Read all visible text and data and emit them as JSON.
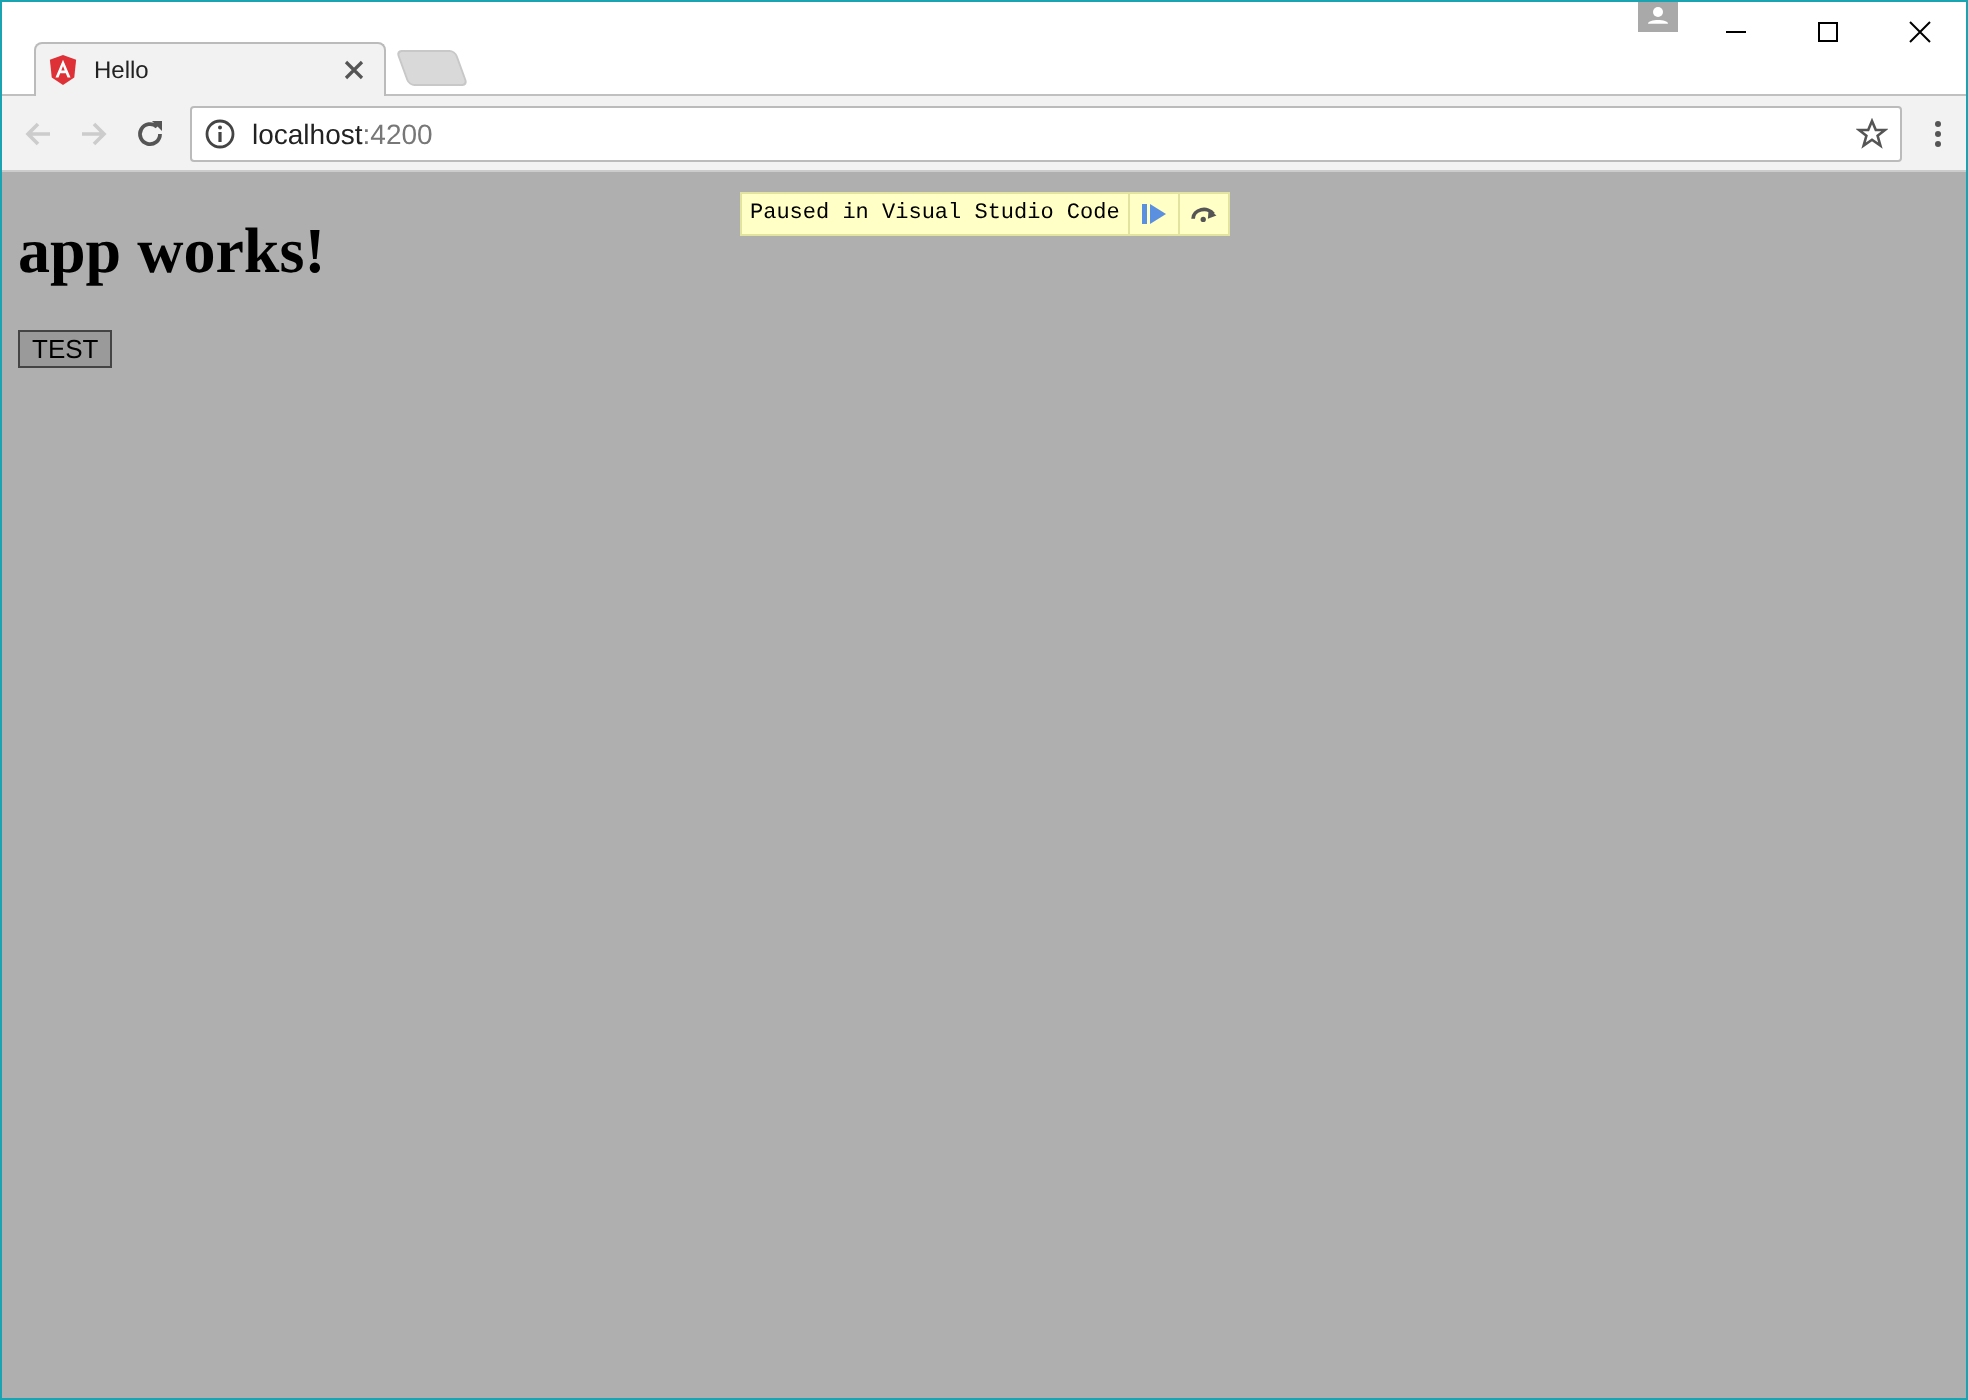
{
  "tabs": [
    {
      "title": "Hello",
      "selected": true
    }
  ],
  "address": {
    "host": "localhost",
    "port": ":4200"
  },
  "debug_banner": {
    "text": "Paused in Visual Studio Code"
  },
  "page": {
    "heading": "app works!",
    "button": "TEST"
  }
}
